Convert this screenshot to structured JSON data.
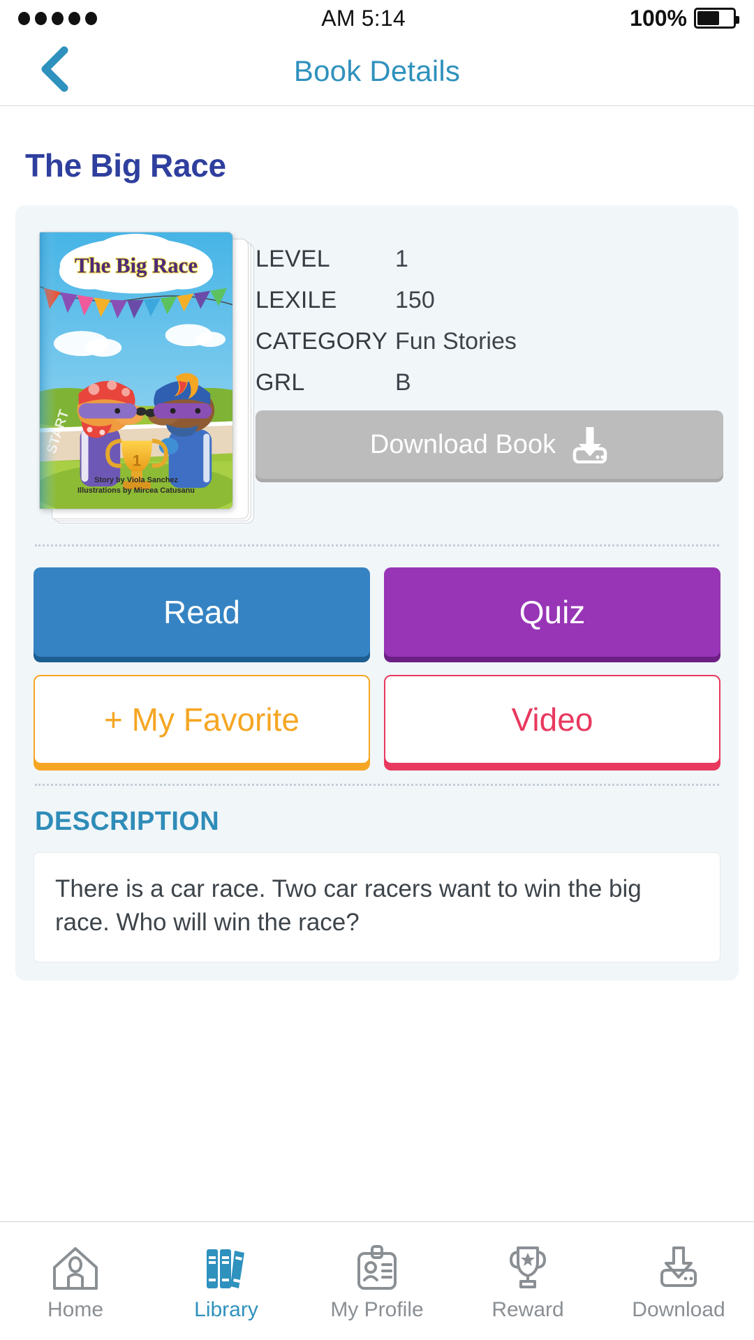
{
  "status_bar": {
    "signal_dots": 5,
    "time": "AM 5:14",
    "battery_percent": "100%"
  },
  "header": {
    "title": "Book Details",
    "back_icon": "chevron-left-icon"
  },
  "book": {
    "title": "The Big Race",
    "cover": {
      "title": "The Big Race",
      "author_line": "Story by Viola Sanchez",
      "illustrator_line": "Illustrations by Mircea Catusanu",
      "start_text": "START",
      "trophy_number": "1"
    },
    "meta": [
      {
        "label": "LEVEL",
        "value": "1"
      },
      {
        "label": "LEXILE",
        "value": "150"
      },
      {
        "label": "CATEGORY",
        "value": "Fun Stories"
      },
      {
        "label": "GRL",
        "value": "B"
      }
    ],
    "download_button": {
      "label": "Download Book",
      "icon": "download-tray-icon",
      "enabled": false
    }
  },
  "actions": {
    "read": "Read",
    "quiz": "Quiz",
    "favorite": "+ My Favorite",
    "video": "Video"
  },
  "description": {
    "heading": "DESCRIPTION",
    "text": "There is a car race. Two car racers want to win the big race. Who will win the race?"
  },
  "tabbar": {
    "items": [
      {
        "label": "Home",
        "icon": "house-icon",
        "active": false
      },
      {
        "label": "Library",
        "icon": "books-icon",
        "active": true
      },
      {
        "label": "My Profile",
        "icon": "id-card-icon",
        "active": false
      },
      {
        "label": "Reward",
        "icon": "trophy-icon",
        "active": false
      },
      {
        "label": "Download",
        "icon": "download-tray-icon",
        "active": false
      }
    ]
  },
  "colors": {
    "accent_teal": "#2f91bd",
    "title_navy": "#2f3f9e",
    "read_blue": "#3583c3",
    "quiz_purple": "#9735b6",
    "favorite_orange": "#f5a623",
    "video_pink": "#e8395e",
    "card_bg": "#f1f6f9",
    "disabled_grey": "#bcbcbc"
  }
}
